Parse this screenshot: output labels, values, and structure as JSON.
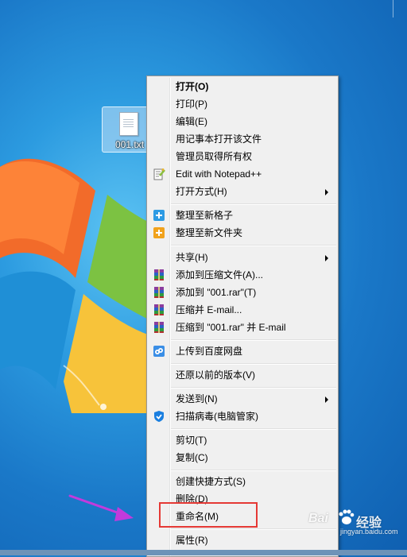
{
  "desktop": {
    "file_icon_label": "001.txt"
  },
  "context_menu": {
    "items": [
      {
        "label": "打开(O)",
        "bold": true
      },
      {
        "label": "打印(P)"
      },
      {
        "label": "编辑(E)"
      },
      {
        "label": "用记事本打开该文件"
      },
      {
        "label": "管理员取得所有权"
      },
      {
        "label": "Edit with Notepad++",
        "icon": "notepad-plus-plus-icon"
      },
      {
        "label": "打开方式(H)",
        "submenu": true
      },
      {
        "label": "整理至新格子",
        "icon": "fences-blue-icon"
      },
      {
        "label": "整理至新文件夹",
        "icon": "fences-folder-icon"
      },
      {
        "label": "共享(H)",
        "submenu": true
      },
      {
        "label": "添加到压缩文件(A)...",
        "icon": "winrar-icon"
      },
      {
        "label": "添加到 \"001.rar\"(T)",
        "icon": "winrar-icon"
      },
      {
        "label": "压缩并 E-mail...",
        "icon": "winrar-icon"
      },
      {
        "label": "压缩到 \"001.rar\" 并 E-mail",
        "icon": "winrar-icon"
      },
      {
        "label": "上传到百度网盘",
        "icon": "baidu-netdisk-icon"
      },
      {
        "label": "还原以前的版本(V)"
      },
      {
        "label": "发送到(N)",
        "submenu": true
      },
      {
        "label": "扫描病毒(电脑管家)",
        "icon": "tencent-pc-manager-icon"
      },
      {
        "label": "剪切(T)"
      },
      {
        "label": "复制(C)"
      },
      {
        "label": "创建快捷方式(S)"
      },
      {
        "label": "删除(D)"
      },
      {
        "label": "重命名(M)",
        "highlighted": true
      },
      {
        "label": "属性(R)"
      }
    ]
  },
  "watermark": {
    "brand": "Bai",
    "text": "经验",
    "url": "jingyan.baidu.com"
  },
  "colors": {
    "highlight_border": "#e53935",
    "pointer_arrow": "#c23bdc",
    "menu_background": "#f0f0f0"
  }
}
